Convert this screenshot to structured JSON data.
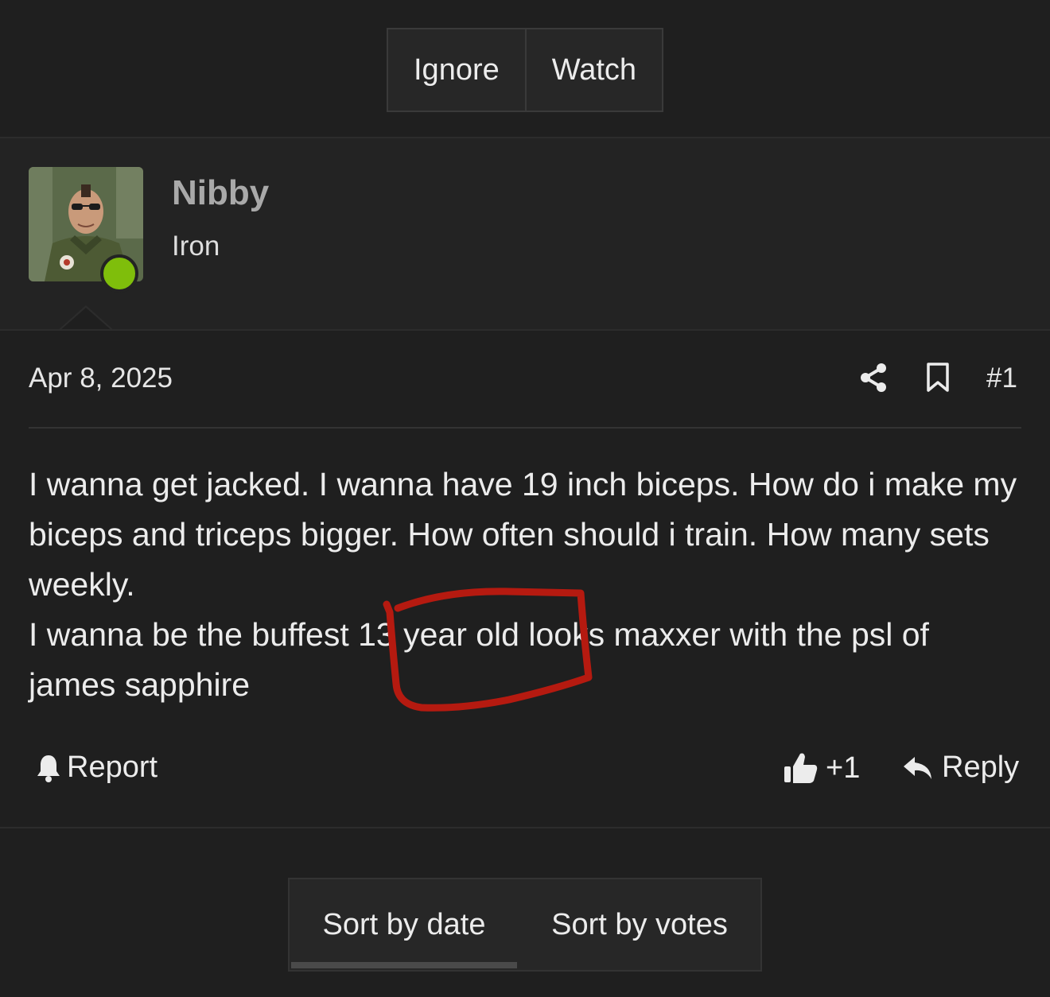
{
  "thread_actions": {
    "ignore": "Ignore",
    "watch": "Watch"
  },
  "user": {
    "name": "Nibby",
    "title": "Iron",
    "online": true,
    "status_color": "#7fbe0b"
  },
  "post": {
    "date": "Apr 8, 2025",
    "number": "#1",
    "paragraphs": [
      "I wanna get jacked. I wanna have 19 inch biceps. How do i make my biceps and triceps bigger. How often should i train. How many sets weekly.",
      "I wanna be the buffest 13 year old looks maxxer with the psl of james sapphire"
    ],
    "icons": [
      "share-icon",
      "bookmark-icon"
    ],
    "annotation_color": "#b51a10"
  },
  "actions": {
    "report": "Report",
    "like_count": "+1",
    "reply": "Reply"
  },
  "sort": {
    "by_date": "Sort by date",
    "by_votes": "Sort by votes",
    "active": "by_date"
  }
}
